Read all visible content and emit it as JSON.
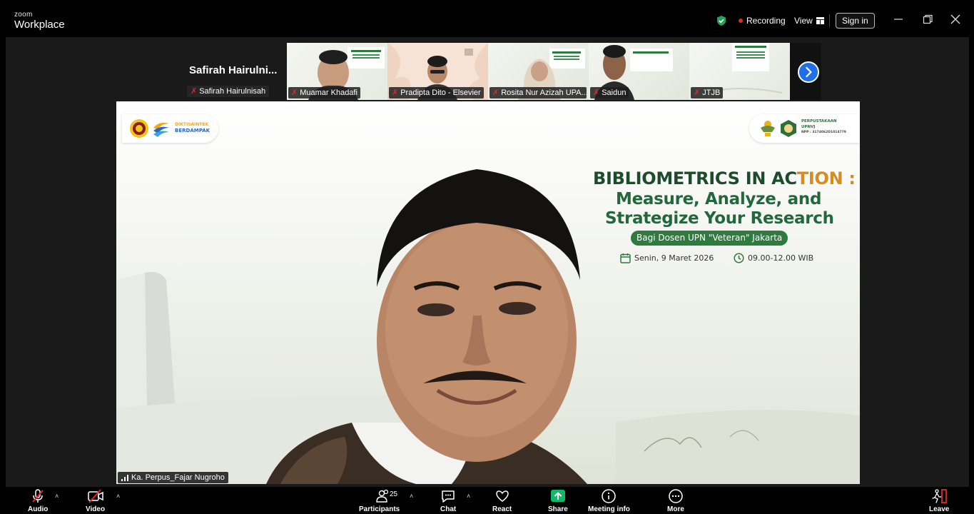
{
  "app": {
    "brand_top": "zoom",
    "brand_bottom": "Workplace"
  },
  "titlebar": {
    "recording_label": "Recording",
    "view_label": "View",
    "sign_in_label": "Sign in"
  },
  "self_view": {
    "display_name": "Safirah  Hairulni...",
    "name_tag": "Safirah Hairulnisah"
  },
  "participants_strip": [
    {
      "name": "Muamar Khadafi"
    },
    {
      "name": "Pradipta Dito - Elsevier"
    },
    {
      "name": "Rosita Nur Azizah UPA..."
    },
    {
      "name": "Saidun"
    },
    {
      "name": "JTJB"
    }
  ],
  "shared_screen": {
    "logo_left_text_1": "DIKTISAINTEK",
    "logo_left_text_2": "BERDAMPAK",
    "logo_right_text_1": "PERPUSTAKAAN",
    "logo_right_text_2": "UPNVJ",
    "logo_right_text_3": "NPP : 3174062D1014779",
    "title_part1": "BIBLIOMETRICS IN AC",
    "title_part2": "TION :",
    "subtitle_line1": "Measure, Analyze, and",
    "subtitle_line2": "Strategize Your Research",
    "audience": "Bagi Dosen UPN \"Veteran\" Jakarta",
    "date": "Senin, 9 Maret 2026",
    "time": "09.00-12.00 WIB"
  },
  "active_speaker": {
    "name": "Ka. Perpus_Fajar Nugroho"
  },
  "toolbar": {
    "audio_label": "Audio",
    "video_label": "Video",
    "participants_label": "Participants",
    "participants_count": "25",
    "chat_label": "Chat",
    "react_label": "React",
    "share_label": "Share",
    "meeting_info_label": "Meeting info",
    "more_label": "More",
    "leave_label": "Leave"
  },
  "colors": {
    "accent_green": "#2f7a3f",
    "title_dark_green": "#1b4d2a",
    "title_orange": "#d98b1e",
    "share_green": "#12b76a",
    "leave_red": "#e02828",
    "nav_blue": "#1f6feb"
  }
}
